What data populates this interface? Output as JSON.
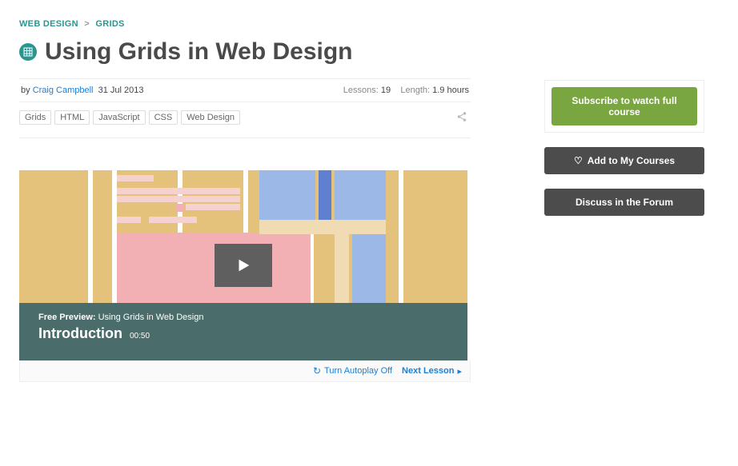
{
  "breadcrumb": {
    "root": "WEB DESIGN",
    "sep": ">",
    "current": "GRIDS"
  },
  "title": "Using Grids in Web Design",
  "meta": {
    "by": "by",
    "author": "Craig Campbell",
    "date": "31 Jul 2013",
    "lessons_label": "Lessons:",
    "lessons_value": "19",
    "length_label": "Length:",
    "length_value": "1.9 hours"
  },
  "tags": [
    "Grids",
    "HTML",
    "JavaScript",
    "CSS",
    "Web Design"
  ],
  "video": {
    "preview_label": "Free Preview:",
    "preview_title": "Using Grids in Web Design",
    "lesson_title": "Introduction",
    "lesson_time": "00:50"
  },
  "footer": {
    "autoplay": "Turn Autoplay Off",
    "next_label": "Next Lesson",
    "next_arrow": "▸"
  },
  "sidebar": {
    "subscribe": "Subscribe to watch full course",
    "add": "Add to My Courses",
    "discuss": "Discuss in the Forum"
  }
}
